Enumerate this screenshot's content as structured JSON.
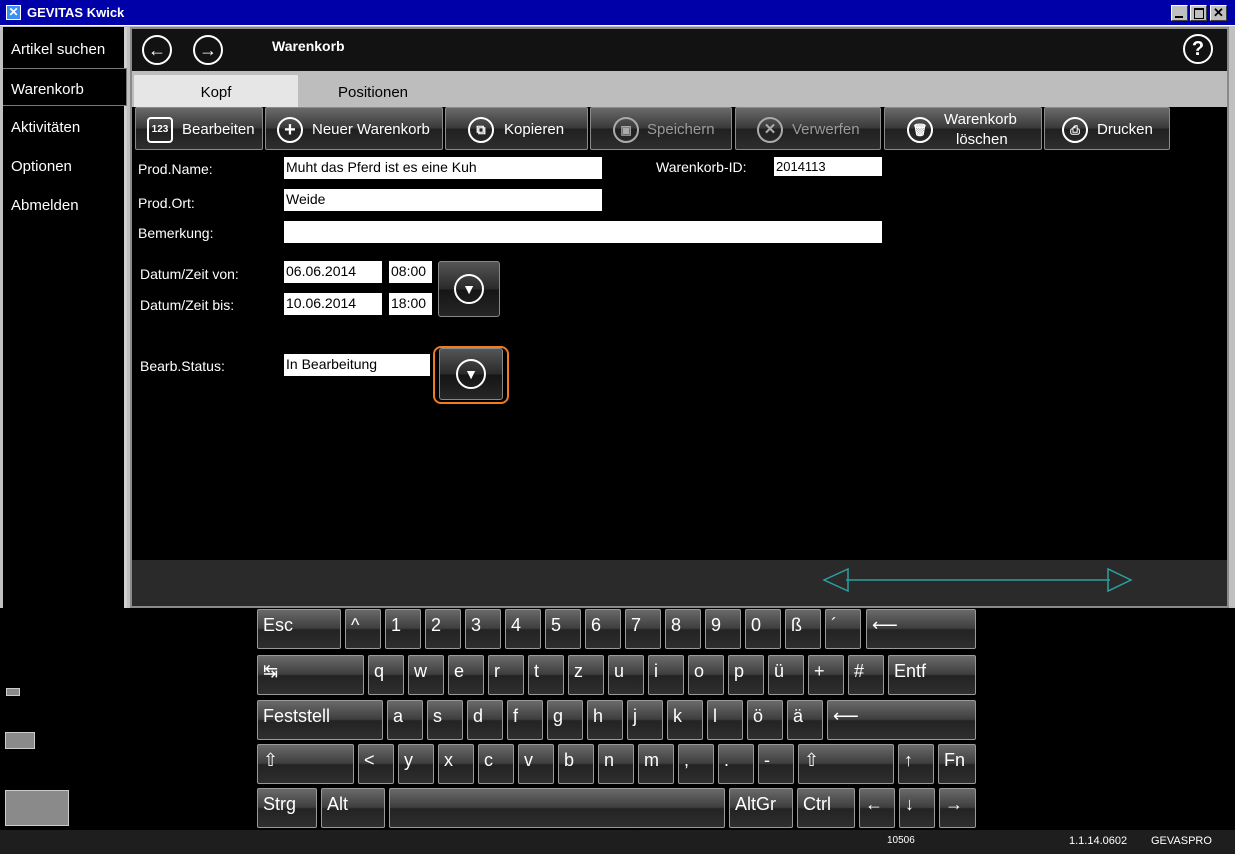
{
  "window": {
    "title": "GEVITAS Kwick"
  },
  "sidebar": {
    "items": [
      {
        "label": "Artikel suchen",
        "active": false
      },
      {
        "label": "Warenkorb",
        "active": true
      },
      {
        "label": "Aktivitäten",
        "active": false
      },
      {
        "label": "Optionen",
        "active": false
      },
      {
        "label": "Abmelden",
        "active": false
      }
    ]
  },
  "header": {
    "title": "Warenkorb",
    "help": "?"
  },
  "tabs": [
    {
      "label": "Kopf",
      "active": true
    },
    {
      "label": "Positionen",
      "active": false
    }
  ],
  "toolbar": {
    "edit": "Bearbeiten",
    "new_cart": "Neuer Warenkorb",
    "copy": "Kopieren",
    "save": "Speichern",
    "discard": "Verwerfen",
    "delete_cart_1": "Warenkorb",
    "delete_cart_2": "löschen",
    "print": "Drucken"
  },
  "form": {
    "prod_name_label": "Prod.Name:",
    "prod_name": "Muht das Pferd ist es eine Kuh",
    "cart_id_label": "Warenkorb-ID:",
    "cart_id": "2014113",
    "prod_ort_label": "Prod.Ort:",
    "prod_ort": "Weide",
    "bemerkung_label": "Bemerkung:",
    "bemerkung": "",
    "from_label": "Datum/Zeit von:",
    "from_date": "06.06.2014",
    "from_time": "08:00",
    "to_label": "Datum/Zeit bis:",
    "to_date": "10.06.2014",
    "to_time": "18:00",
    "status_label": "Bearb.Status:",
    "status": "In Bearbeitung"
  },
  "keyboard": {
    "rows": [
      [
        "Esc",
        "^",
        "1",
        "2",
        "3",
        "4",
        "5",
        "6",
        "7",
        "8",
        "9",
        "0",
        "ß",
        "´"
      ],
      [
        "q",
        "w",
        "e",
        "r",
        "t",
        "z",
        "u",
        "i",
        "o",
        "p",
        "ü",
        "+",
        "#",
        "Entf"
      ],
      [
        "Feststell",
        "a",
        "s",
        "d",
        "f",
        "g",
        "h",
        "j",
        "k",
        "l",
        "ö",
        "ä"
      ],
      [
        "<",
        "y",
        "x",
        "c",
        "v",
        "b",
        "n",
        "m",
        ",",
        ".",
        "-",
        "↑",
        "Fn"
      ],
      [
        "Strg",
        "Alt",
        "AltGr",
        "Ctrl",
        "←",
        "↓",
        "→"
      ]
    ]
  },
  "status": {
    "code": "10506",
    "version": "1.1.14.0602",
    "vendor": "GEVASPRO"
  }
}
